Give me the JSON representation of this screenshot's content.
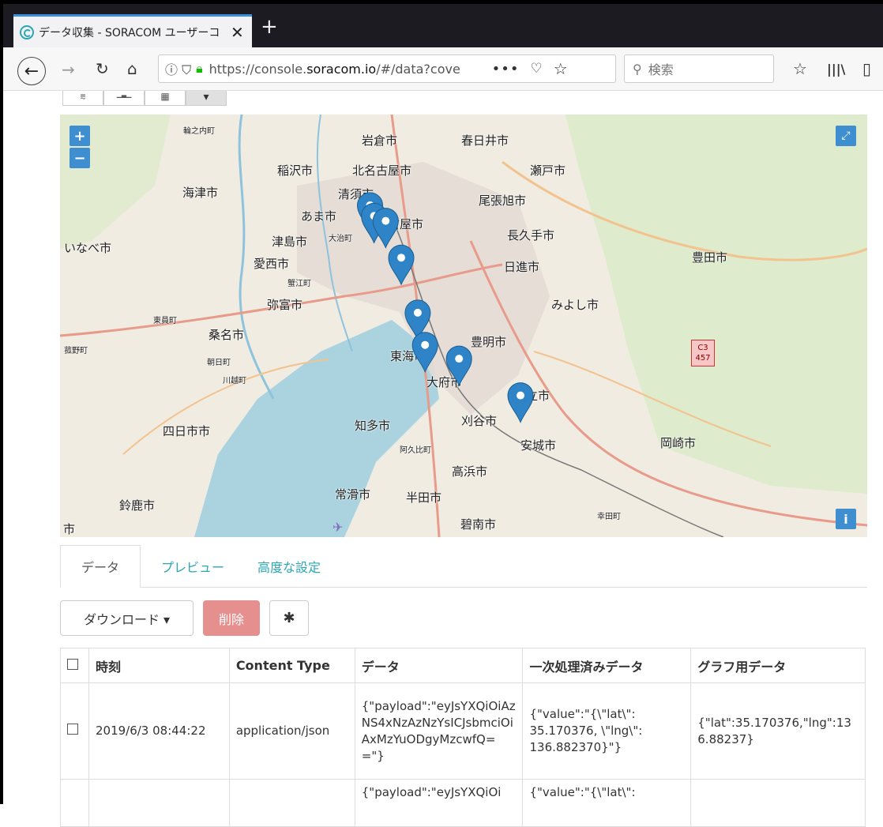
{
  "browser": {
    "tab_title": "データ収集 - SORACOM ユーザーコ",
    "tab_close": "✕",
    "new_tab": "+",
    "url_prefix": "https://console.",
    "url_domain": "soracom.io",
    "url_suffix": "/#/data?cove",
    "url_dots": "•••",
    "search_placeholder": "検索"
  },
  "view_toggle": [
    {
      "name": "line-chart-icon",
      "glyph": "⩳"
    },
    {
      "name": "bar-chart-icon",
      "glyph": "▁▃▁"
    },
    {
      "name": "table-icon",
      "glyph": "▦"
    },
    {
      "name": "map-icon",
      "glyph": "▾"
    }
  ],
  "map": {
    "zoom_in": "+",
    "zoom_out": "−",
    "info": "i",
    "route_badge": "C3\n457",
    "labels": [
      {
        "text": "輪之内町",
        "small": true
      },
      {
        "text": "岩倉市"
      },
      {
        "text": "春日井市"
      },
      {
        "text": "稲沢市"
      },
      {
        "text": "北名古屋市"
      },
      {
        "text": "瀬戸市"
      },
      {
        "text": "海津市"
      },
      {
        "text": "清須市"
      },
      {
        "text": "尾張旭市"
      },
      {
        "text": "あま市"
      },
      {
        "text": "名古屋市"
      },
      {
        "text": "津島市"
      },
      {
        "text": "大治町",
        "small": true
      },
      {
        "text": "長久手市"
      },
      {
        "text": "いなべ市"
      },
      {
        "text": "愛西市"
      },
      {
        "text": "豊田市"
      },
      {
        "text": "日進市"
      },
      {
        "text": "蟹江町",
        "small": true
      },
      {
        "text": "弥富市"
      },
      {
        "text": "みよし市"
      },
      {
        "text": "東員町",
        "small": true
      },
      {
        "text": "桑名市"
      },
      {
        "text": "豊明市"
      },
      {
        "text": "菰野町",
        "small": true
      },
      {
        "text": "朝日町",
        "small": true
      },
      {
        "text": "東海市"
      },
      {
        "text": "川越町",
        "small": true
      },
      {
        "text": "大府市"
      },
      {
        "text": "知立市"
      },
      {
        "text": "知多市"
      },
      {
        "text": "刈谷市"
      },
      {
        "text": "四日市市"
      },
      {
        "text": "阿久比町",
        "small": true
      },
      {
        "text": "安城市"
      },
      {
        "text": "岡崎市"
      },
      {
        "text": "高浜市"
      },
      {
        "text": "常滑市"
      },
      {
        "text": "半田市"
      },
      {
        "text": "鈴鹿市"
      },
      {
        "text": "幸田町",
        "small": true
      },
      {
        "text": "碧南市"
      },
      {
        "text": "市"
      }
    ],
    "markers": [
      {
        "lat": 35.182,
        "lng": 136.878
      },
      {
        "lat": 35.170376,
        "lng": 136.88237
      },
      {
        "lat": 35.165,
        "lng": 136.895
      },
      {
        "lat": 35.125,
        "lng": 136.912
      },
      {
        "lat": 35.065,
        "lng": 136.93
      },
      {
        "lat": 35.03,
        "lng": 136.938
      },
      {
        "lat": 35.015,
        "lng": 136.975
      },
      {
        "lat": 34.975,
        "lng": 137.042
      }
    ]
  },
  "tabs": {
    "data": "データ",
    "preview": "プレビュー",
    "advanced": "高度な設定"
  },
  "actions": {
    "download": "ダウンロード ▾",
    "delete": "削除",
    "settings_icon": "✱"
  },
  "table": {
    "headers": [
      "時刻",
      "Content Type",
      "データ",
      "一次処理済みデータ",
      "グラフ用データ"
    ],
    "rows": [
      {
        "time": "2019/6/3 08:44:22",
        "content_type": "application/json",
        "data": "{\"payload\":\"eyJsYXQiOiAzNS4xNzAzNzYsICJsbmciOiAxMzYuODgyMzcwfQ==\"}",
        "processed": "{\"value\":\"{\\\"lat\\\": 35.170376, \\\"lng\\\": 136.882370}\"}",
        "graph": "{\"lat\":35.170376,\"lng\":136.88237}"
      },
      {
        "time": "",
        "content_type": "",
        "data": "{\"payload\":\"eyJsYXQiOi",
        "processed": "{\"value\":\"{\\\"lat\\\":",
        "graph": ""
      }
    ]
  }
}
